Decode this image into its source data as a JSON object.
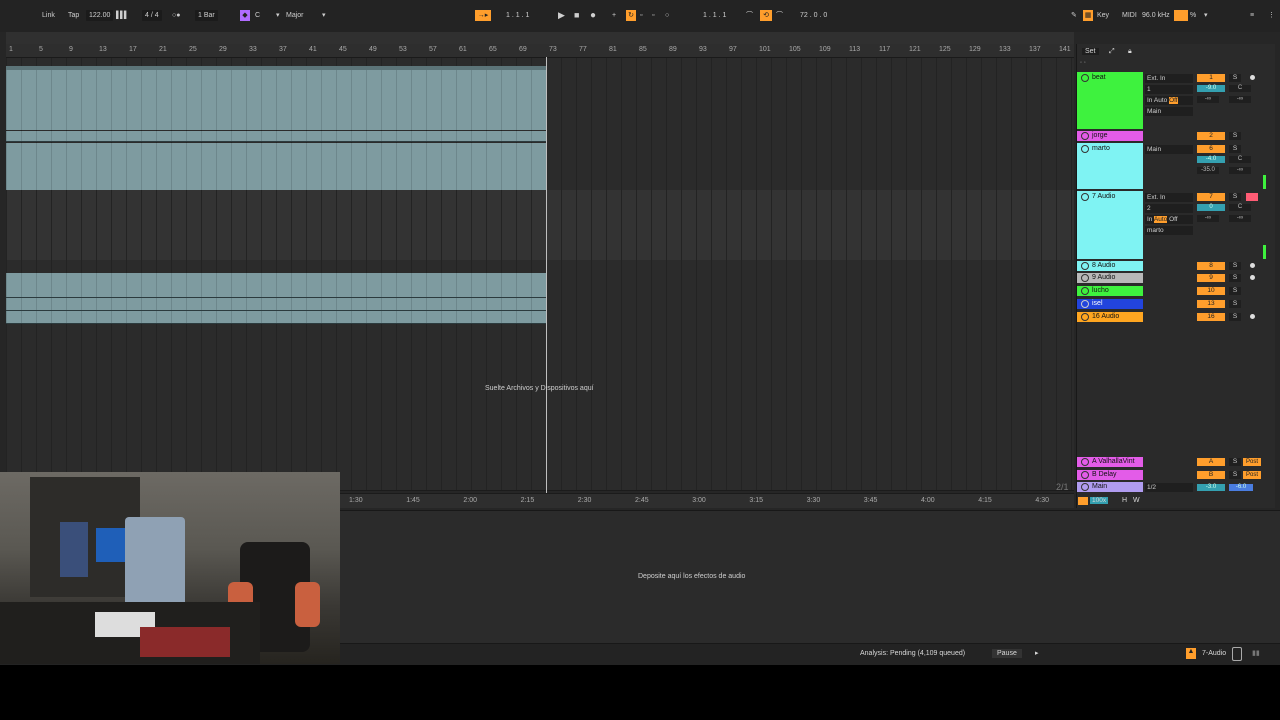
{
  "topbar": {
    "link": "Link",
    "tap": "Tap",
    "tempo": "122.00",
    "time_signature": "4 / 4",
    "quantize": "1 Bar",
    "key": "C",
    "scale": "Major",
    "position": "1 .  1 .  1",
    "loop_start": "1 .  1 .  1",
    "loop_length": "72 .  0 .  0",
    "key_map": "Key",
    "midi_map": "MIDI",
    "sample_rate": "96.0 kHz",
    "cpu": "%"
  },
  "ruler": {
    "bars": [
      "1",
      "5",
      "9",
      "13",
      "17",
      "21",
      "25",
      "29",
      "33",
      "37",
      "41",
      "45",
      "49",
      "53",
      "57",
      "61",
      "65",
      "69",
      "73",
      "77",
      "81",
      "85",
      "89",
      "93",
      "97",
      "101",
      "105",
      "109",
      "113",
      "117",
      "121",
      "125",
      "129",
      "133",
      "137",
      "141"
    ],
    "times": [
      "1:30",
      "1:45",
      "2:00",
      "2:15",
      "2:30",
      "2:45",
      "3:00",
      "3:15",
      "3:30",
      "3:45",
      "4:00",
      "4:15",
      "4:30"
    ]
  },
  "arrangement": {
    "drop_hint": "Suelte Archivos y Dispositivos aquí",
    "page_indicator": "2/1"
  },
  "set_button": "Set",
  "tracks": [
    {
      "name": "beat",
      "color": "#3ef23e",
      "input": "Ext. In",
      "channel": "1",
      "monitor": [
        "In",
        "Auto",
        "Off"
      ],
      "output": "Main",
      "number": "1",
      "volume": "-9.0",
      "pan": "C"
    },
    {
      "name": "jorge",
      "color": "#e35ce8",
      "number": "2"
    },
    {
      "name": "marto",
      "color": "#7ff3f3",
      "output": "Main",
      "number": "6",
      "volume": "-4.0",
      "pan": "C",
      "send": "-35.0"
    },
    {
      "name": "7 Audio",
      "color": "#7ff3f3",
      "input": "Ext. In",
      "channel": "2",
      "monitor": [
        "In",
        "Auto",
        "Off"
      ],
      "output": "marto",
      "number": "7",
      "volume": "0",
      "pan": "C"
    },
    {
      "name": "8 Audio",
      "color": "#7ff3f3",
      "number": "8"
    },
    {
      "name": "9 Audio",
      "color": "#b8b8b8",
      "number": "9"
    },
    {
      "name": "lucho",
      "color": "#3ef23e",
      "number": "10"
    },
    {
      "name": "isel",
      "color": "#2244dd",
      "number": "13"
    },
    {
      "name": "16 Audio",
      "color": "#ffa620",
      "number": "16"
    }
  ],
  "returns": [
    {
      "name": "A ValhallaVint",
      "color": "#e35ce8",
      "letter": "A",
      "post": "Post"
    },
    {
      "name": "B Delay",
      "color": "#e35ce8",
      "letter": "B",
      "post": "Post"
    },
    {
      "name": "Main",
      "color": "#b09cf0",
      "output": "1/2",
      "volume": "-3.0",
      "pan": "-6.0"
    }
  ],
  "mixer_footer": {
    "zoom": "100x",
    "h": "H",
    "w": "W",
    "minus_inf": "-∞",
    "s": "S"
  },
  "device": {
    "hint": "Deposite aquí los efectos de audio"
  },
  "status": {
    "analysis": "Analysis: Pending (4,109 queued)",
    "pause": "Pause",
    "selected_track": "7-Audio"
  }
}
